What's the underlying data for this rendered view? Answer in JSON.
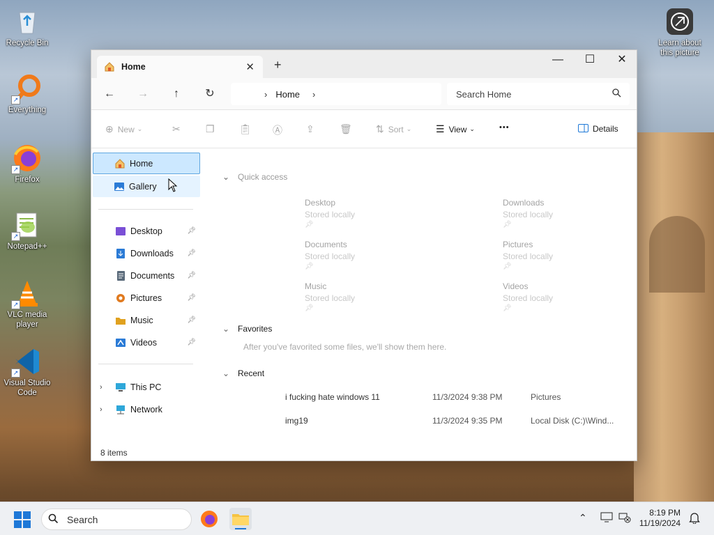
{
  "desktop": {
    "icons": [
      {
        "label": "Recycle Bin",
        "icon": "recycle-bin-icon"
      },
      {
        "label": "Everything",
        "icon": "everything-search-icon"
      },
      {
        "label": "Firefox",
        "icon": "firefox-icon"
      },
      {
        "label": "Notepad++",
        "icon": "notepadpp-icon"
      },
      {
        "label": "VLC media player",
        "icon": "vlc-icon"
      },
      {
        "label": "Visual Studio Code",
        "icon": "vscode-icon"
      }
    ],
    "learn_about": "Learn about this picture"
  },
  "window": {
    "tab_title": "Home",
    "tab_close": "✕",
    "new_tab": "+",
    "controls": {
      "minimize": "—",
      "maximize": "☐",
      "close": "✕"
    },
    "nav": {
      "back": "←",
      "forward": "→",
      "up": "↑",
      "refresh": "↻"
    },
    "breadcrumb": {
      "sep": "›",
      "current": "Home"
    },
    "search_placeholder": "Search Home",
    "toolbar": {
      "new_label": "New",
      "sort_label": "Sort",
      "view_label": "View",
      "more_label": "•••",
      "details_label": "Details"
    },
    "sidebar": {
      "home": "Home",
      "gallery": "Gallery",
      "pinned": [
        {
          "label": "Desktop",
          "icon": "desktop-folder-icon",
          "color": "#7a4fd6"
        },
        {
          "label": "Downloads",
          "icon": "downloads-folder-icon",
          "color": "#2b7bd6"
        },
        {
          "label": "Documents",
          "icon": "documents-folder-icon",
          "color": "#5a6a7a"
        },
        {
          "label": "Pictures",
          "icon": "pictures-folder-icon",
          "color": "#e07a1f"
        },
        {
          "label": "Music",
          "icon": "music-folder-icon",
          "color": "#e0a11f"
        },
        {
          "label": "Videos",
          "icon": "videos-folder-icon",
          "color": "#2b7bd6"
        }
      ],
      "this_pc": "This PC",
      "network": "Network"
    },
    "content": {
      "quick_access_title": "Quick access",
      "quick_access": [
        {
          "name": "Desktop",
          "sub": "Stored locally"
        },
        {
          "name": "Downloads",
          "sub": "Stored locally"
        },
        {
          "name": "Documents",
          "sub": "Stored locally"
        },
        {
          "name": "Pictures",
          "sub": "Stored locally"
        },
        {
          "name": "Music",
          "sub": "Stored locally"
        },
        {
          "name": "Videos",
          "sub": "Stored locally"
        }
      ],
      "favorites_title": "Favorites",
      "favorites_empty": "After you've favorited some files, we'll show them here.",
      "recent_title": "Recent",
      "recent": [
        {
          "name": "i fucking hate windows 11",
          "date": "11/3/2024 9:38 PM",
          "location": "Pictures"
        },
        {
          "name": "img19",
          "date": "11/3/2024 9:35 PM",
          "location": "Local Disk (C:)\\Wind..."
        }
      ]
    },
    "status": "8 items"
  },
  "taskbar": {
    "search": "Search",
    "time": "8:19 PM",
    "date": "11/19/2024"
  },
  "colors": {
    "accent": "#1e78d7",
    "selection": "#cce8ff"
  }
}
